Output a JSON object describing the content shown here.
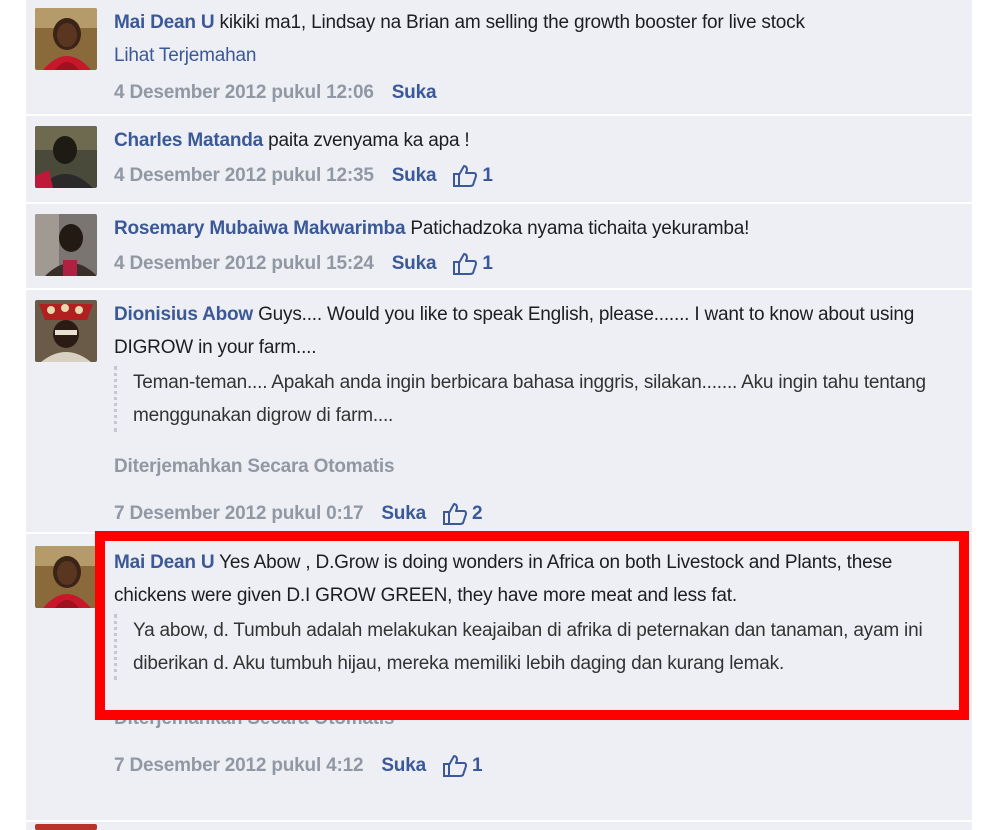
{
  "comments": [
    {
      "author": "Mai Dean U",
      "text": "kikiki ma1, Lindsay na Brian am selling the growth booster for live stock",
      "see_translation": "Lihat Terjemahan",
      "timestamp": "4 Desember 2012 pukul 12:06",
      "like_label": "Suka",
      "like_count": ""
    },
    {
      "author": "Charles Matanda",
      "text": "paita zvenyama ka apa !",
      "timestamp": "4 Desember 2012 pukul 12:35",
      "like_label": "Suka",
      "like_count": "1"
    },
    {
      "author": "Rosemary Mubaiwa Makwarimba",
      "text": "Patichadzoka nyama tichaita yekuramba!",
      "timestamp": "4 Desember 2012 pukul 15:24",
      "like_label": "Suka",
      "like_count": "1"
    },
    {
      "author": "Dionisius Abow",
      "text": "Guys.... Would you like to speak English, please....... I want to know about using DIGROW in your farm....",
      "translation": "Teman-teman.... Apakah anda ingin berbicara bahasa inggris, silakan....... Aku ingin tahu tentang menggunakan digrow di farm....",
      "auto_translated": "Diterjemahkan Secara Otomatis",
      "timestamp": "7 Desember 2012 pukul 0:17",
      "like_label": "Suka",
      "like_count": "2"
    },
    {
      "author": "Mai Dean U",
      "text": "Yes Abow , D.Grow is doing wonders in Africa on both Livestock and Plants, these chickens were given D.I GROW GREEN, they have more meat and less fat.",
      "translation": "Ya abow, d. Tumbuh adalah melakukan keajaiban di afrika di peternakan dan tanaman, ayam ini diberikan d. Aku tumbuh hijau, mereka memiliki lebih daging dan kurang lemak.",
      "auto_translated": "Diterjemahkan Secara Otomatis",
      "timestamp": "7 Desember 2012 pukul 4:12",
      "like_label": "Suka",
      "like_count": "1"
    }
  ],
  "colors": {
    "link": "#3b5998",
    "muted": "#9197a3",
    "background": "#edeff4",
    "highlight": "#ff0000"
  },
  "icons": {
    "like": "thumbs-up-icon"
  }
}
